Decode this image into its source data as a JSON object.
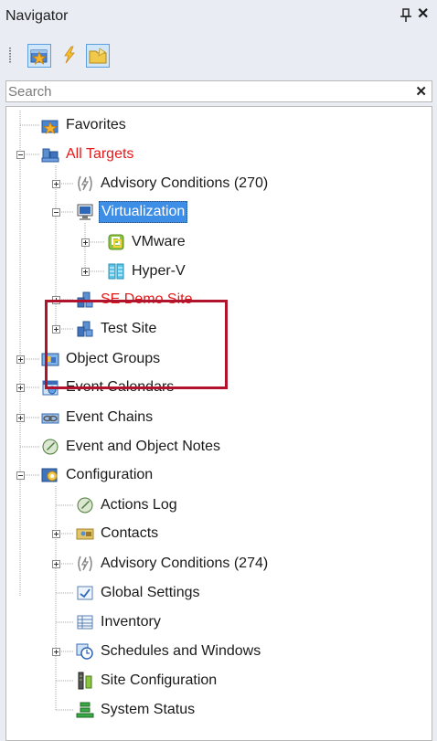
{
  "panel": {
    "title": "Navigator"
  },
  "toolbar": {
    "buttons": [
      "favorites-icon",
      "lightning-icon",
      "folder-icon"
    ]
  },
  "search": {
    "placeholder": "Search",
    "value": ""
  },
  "colors": {
    "selection": "#3d8ee6",
    "red_text": "#e51a1a",
    "highlight_box": "#b0132b"
  },
  "tree": {
    "favorites": "Favorites",
    "all_targets": "All Targets",
    "advisory_conditions_1": "Advisory Conditions (270)",
    "virtualization": "Virtualization",
    "vmware": "VMware",
    "hyperv": "Hyper-V",
    "se_demo_site": "SE Demo Site",
    "test_site": "Test Site",
    "object_groups": "Object Groups",
    "event_calendars": "Event Calendars",
    "event_chains": "Event Chains",
    "event_object_notes": "Event and Object Notes",
    "configuration": "Configuration",
    "actions_log": "Actions Log",
    "contacts": "Contacts",
    "advisory_conditions_2": "Advisory Conditions (274)",
    "global_settings": "Global Settings",
    "inventory": "Inventory",
    "schedules_windows": "Schedules and Windows",
    "site_configuration": "Site Configuration",
    "system_status": "System Status"
  }
}
